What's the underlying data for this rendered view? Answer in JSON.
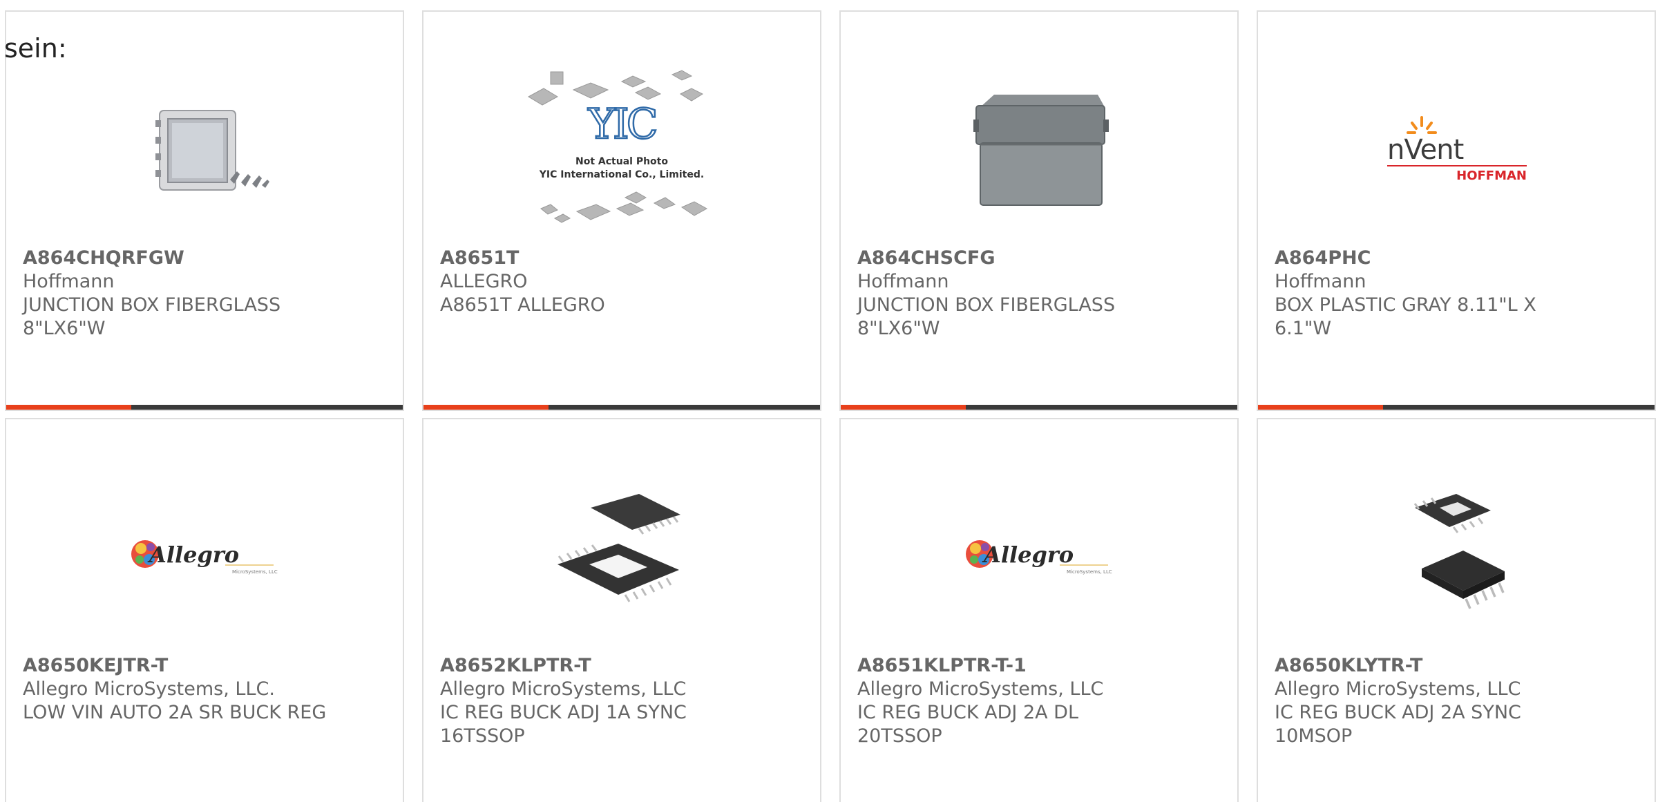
{
  "intro_text": "sein:",
  "products": [
    {
      "part": "A864CHQRFGW",
      "manufacturer": "Hoffmann",
      "description": "JUNCTION BOX FIBERGLASS\n8\"LX6\"W",
      "image": "fiberglass-enclosure-clear-lid"
    },
    {
      "part": "A8651T",
      "manufacturer": "ALLEGRO",
      "description": "A8651T ALLEGRO",
      "image": "not-actual-photo-placeholder",
      "image_text": {
        "logo": "YIC",
        "line1": "Not Actual Photo",
        "line2": "YIC International Co., Limited."
      }
    },
    {
      "part": "A864CHSCFG",
      "manufacturer": "Hoffmann",
      "description": "JUNCTION BOX FIBERGLASS\n8\"LX6\"W",
      "image": "gray-enclosure"
    },
    {
      "part": "A864PHC",
      "manufacturer": "Hoffmann",
      "description": "BOX PLASTIC GRAY 8.11\"L X\n6.1\"W",
      "image": "nvent-hoffman-logo",
      "image_text": {
        "brand": "nVent",
        "sub": "HOFFMAN"
      }
    },
    {
      "part": "A8650KEJTR-T",
      "manufacturer": "Allegro MicroSystems, LLC.",
      "description": "LOW VIN AUTO 2A SR BUCK REG",
      "image": "allegro-logo",
      "image_text": {
        "brand": "Allegro",
        "sub": "MicroSystems, LLC"
      }
    },
    {
      "part": "A8652KLPTR-T",
      "manufacturer": "Allegro MicroSystems, LLC",
      "description": "IC REG BUCK ADJ 1A SYNC\n16TSSOP",
      "image": "tssop-chip"
    },
    {
      "part": "A8651KLPTR-T-1",
      "manufacturer": "Allegro MicroSystems, LLC",
      "description": "IC REG BUCK ADJ 2A DL\n20TSSOP",
      "image": "allegro-logo",
      "image_text": {
        "brand": "Allegro",
        "sub": "MicroSystems, LLC"
      }
    },
    {
      "part": "A8650KLYTR-T",
      "manufacturer": "Allegro MicroSystems, LLC",
      "description": "IC REG BUCK ADJ 2A SYNC\n10MSOP",
      "image": "msop-chip"
    }
  ],
  "colors": {
    "accent": "#e8401b",
    "bar": "#3a3a3a",
    "border": "#dedede",
    "text": "#666666"
  }
}
